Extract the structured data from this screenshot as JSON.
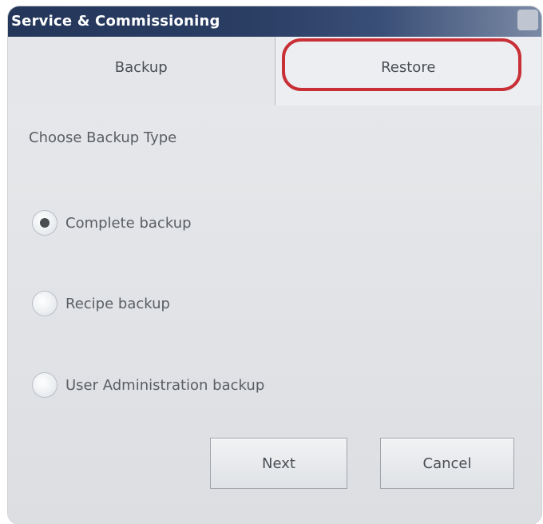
{
  "window": {
    "title": "Service & Commissioning"
  },
  "tabs": [
    {
      "label": "Backup",
      "selected": false
    },
    {
      "label": "Restore",
      "selected": true
    }
  ],
  "section": {
    "label": "Choose Backup Type"
  },
  "options": [
    {
      "label": "Complete backup",
      "checked": true
    },
    {
      "label": "Recipe backup",
      "checked": false
    },
    {
      "label": "User Administration backup",
      "checked": false
    }
  ],
  "buttons": {
    "next": "Next",
    "cancel": "Cancel"
  },
  "colors": {
    "titlebar": "#24365a",
    "highlight": "#c82f36"
  }
}
